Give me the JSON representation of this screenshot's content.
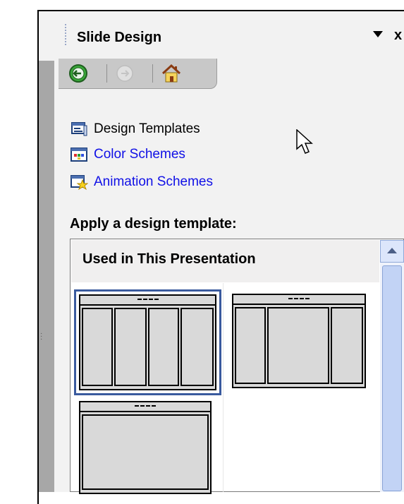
{
  "pane": {
    "title": "Slide Design",
    "close_glyph": "x"
  },
  "nav": {
    "back_icon": "back-arrow-icon",
    "forward_icon": "forward-arrow-icon",
    "home_icon": "home-icon"
  },
  "links": [
    {
      "label": "Design Templates",
      "icon": "design-templates-icon",
      "color": "#000000"
    },
    {
      "label": "Color Schemes",
      "icon": "color-schemes-icon",
      "color": "#1010e6"
    },
    {
      "label": "Animation Schemes",
      "icon": "animation-schemes-icon",
      "color": "#1010e6"
    }
  ],
  "gallery": {
    "heading": "Apply a design template:",
    "group_label": "Used in This Presentation",
    "templates": [
      {
        "layout": "four-column",
        "selected": true
      },
      {
        "layout": "three-column",
        "selected": false
      },
      {
        "layout": "single",
        "selected": false
      }
    ]
  },
  "colors": {
    "selection_border": "#3a5a9e",
    "link_blue": "#1010e6",
    "pane_background": "#f2f2f2",
    "scrollbar": "#c2d3f5"
  }
}
